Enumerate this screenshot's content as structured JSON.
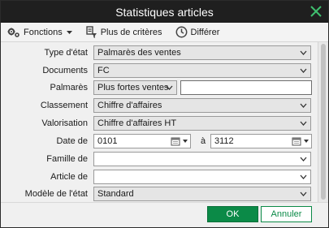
{
  "window": {
    "title": "Statistiques articles"
  },
  "toolbar": {
    "functions_label": "Fonctions",
    "criteria_label": "Plus de critères",
    "defer_label": "Différer"
  },
  "form": {
    "type_etat": {
      "label": "Type d'état",
      "value": "Palmarès des ventes"
    },
    "documents": {
      "label": "Documents",
      "value": "FC"
    },
    "palmares": {
      "label": "Palmarès",
      "value": "Plus fortes ventes",
      "text_value": ""
    },
    "classement": {
      "label": "Classement",
      "value": "Chiffre d'affaires"
    },
    "valorisation": {
      "label": "Valorisation",
      "value": "Chiffre d'affaires HT"
    },
    "date": {
      "label": "Date de",
      "from": "0101",
      "to_label": "à",
      "to": "3112"
    },
    "famille": {
      "label": "Famille de",
      "value": ""
    },
    "article": {
      "label": "Article de",
      "value": ""
    },
    "modele": {
      "label": "Modèle de l'état",
      "value": "Standard"
    }
  },
  "buttons": {
    "ok": "OK",
    "cancel": "Annuler"
  },
  "colors": {
    "accent": "#0b8a47",
    "titlebar": "#1f1f1f"
  }
}
